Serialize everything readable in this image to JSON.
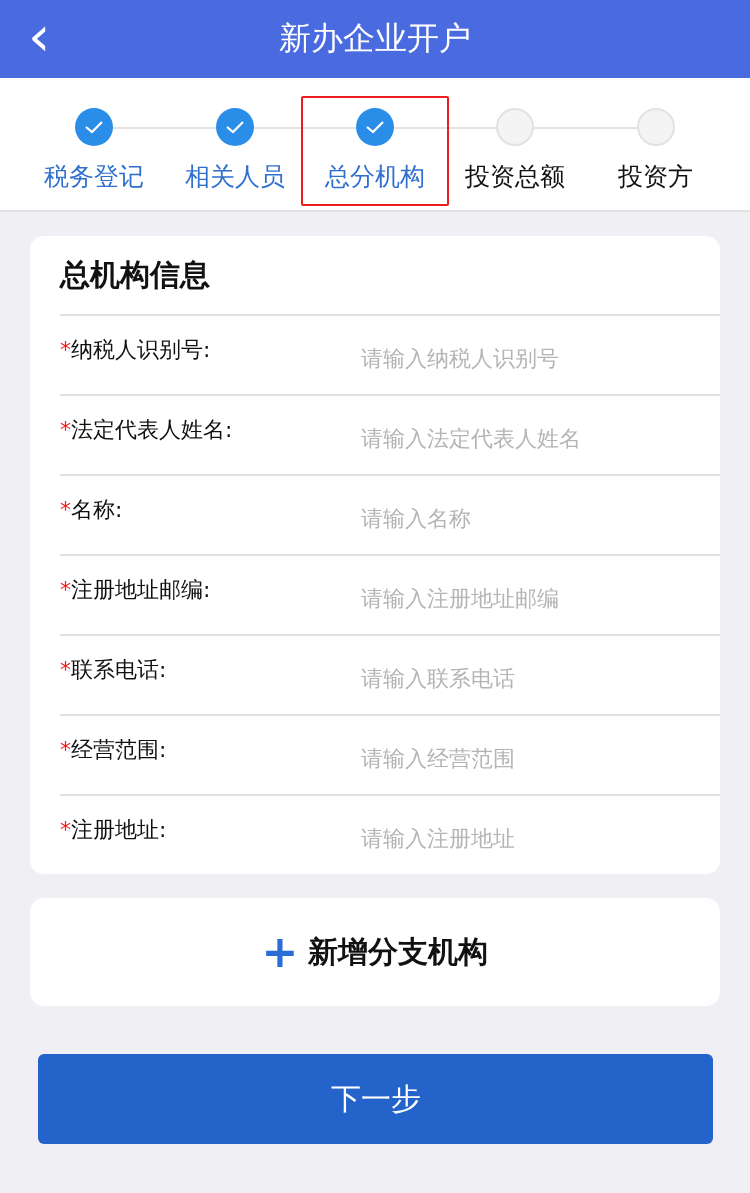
{
  "header": {
    "back_icon": "‹",
    "title": "新办企业开户"
  },
  "steps": [
    {
      "label": "税务登记",
      "done": true,
      "highlighted": false
    },
    {
      "label": "相关人员",
      "done": true,
      "highlighted": false
    },
    {
      "label": "总分机构",
      "done": true,
      "highlighted": true
    },
    {
      "label": "投资总额",
      "done": false,
      "highlighted": false
    },
    {
      "label": "投资方",
      "done": false,
      "highlighted": false
    }
  ],
  "form": {
    "title": "总机构信息",
    "fields": [
      {
        "required_mark": "*",
        "label": "纳税人识别号:",
        "placeholder": "请输入纳税人识别号"
      },
      {
        "required_mark": "*",
        "label": "法定代表人姓名:",
        "placeholder": "请输入法定代表人姓名"
      },
      {
        "required_mark": "*",
        "label": "名称:",
        "placeholder": "请输入名称"
      },
      {
        "required_mark": "*",
        "label": "注册地址邮编:",
        "placeholder": "请输入注册地址邮编"
      },
      {
        "required_mark": "*",
        "label": "联系电话:",
        "placeholder": "请输入联系电话"
      },
      {
        "required_mark": "*",
        "label": "经营范围:",
        "placeholder": "请输入经营范围"
      },
      {
        "required_mark": "*",
        "label": "注册地址:",
        "placeholder": "请输入注册地址"
      }
    ]
  },
  "add_branch": {
    "icon": "+",
    "label": "新增分支机构"
  },
  "next_button": "下一步"
}
